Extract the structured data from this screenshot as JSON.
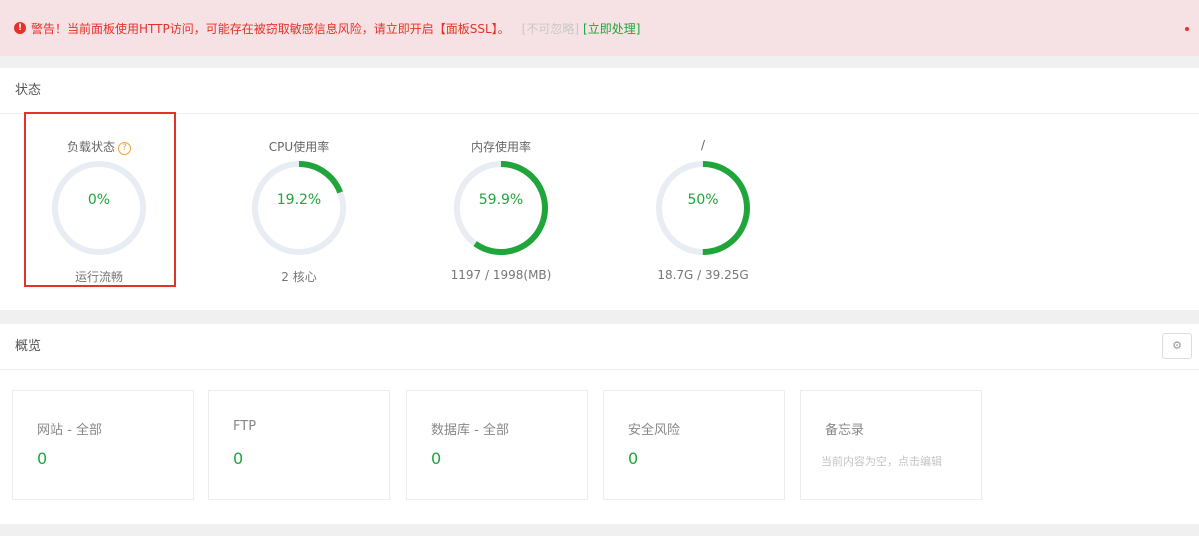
{
  "alert": {
    "icon": "exclamation-circle-icon",
    "message": "警告！当前面板使用HTTP访问，可能存在被窃取敏感信息风险，请立即开启【面板SSL】。",
    "ignore_label": "[不可忽略]",
    "handle_label": "[立即处理]"
  },
  "status": {
    "title": "状态",
    "gauges": [
      {
        "name": "负载状态",
        "value": "0%",
        "fraction": 0.0,
        "sub": "运行流畅",
        "has_help": true,
        "help_glyph": "?"
      },
      {
        "name": "CPU使用率",
        "value": "19.2%",
        "fraction": 0.192,
        "sub": "2 核心"
      },
      {
        "name": "内存使用率",
        "value": "59.9%",
        "fraction": 0.599,
        "sub": "1197 / 1998(MB)"
      },
      {
        "name": "/",
        "value": "50%",
        "fraction": 0.5,
        "sub": "18.7G / 39.25G"
      }
    ]
  },
  "overview": {
    "title": "概览",
    "settings_icon": "settings-icon",
    "settings_glyph": "⚙",
    "cards": [
      {
        "title": "网站 - 全部",
        "value": "0"
      },
      {
        "title": "FTP",
        "value": "0"
      },
      {
        "title": "数据库 - 全部",
        "value": "0"
      },
      {
        "title": "安全风险",
        "value": "0"
      },
      {
        "title": "备忘录",
        "note": "当前内容为空，点击编辑"
      }
    ]
  },
  "colors": {
    "accent": "#20a53a",
    "danger": "#e6312b",
    "ring_track": "#e8ecf3",
    "alert_bg": "#f6e2e4"
  }
}
